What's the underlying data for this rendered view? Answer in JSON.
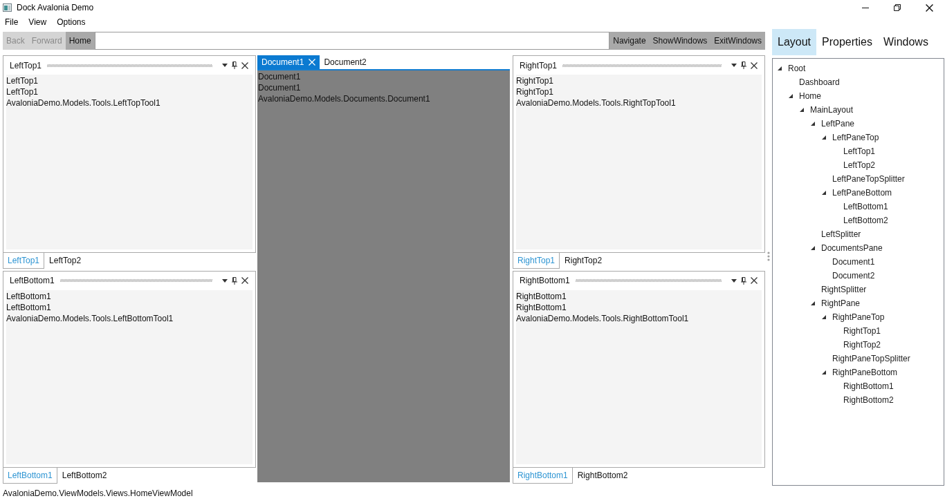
{
  "window": {
    "title": "Dock Avalonia Demo"
  },
  "menu": [
    "File",
    "View",
    "Options"
  ],
  "toolbar": {
    "nav_buttons": [
      {
        "label": "Back",
        "disabled": true
      },
      {
        "label": "Forward",
        "disabled": true
      },
      {
        "label": "Home",
        "disabled": false
      }
    ],
    "action_buttons": [
      {
        "label": "Navigate",
        "disabled": false
      },
      {
        "label": "ShowWindows",
        "disabled": false
      },
      {
        "label": "ExitWindows",
        "disabled": false
      }
    ]
  },
  "dock": {
    "left_panes": [
      {
        "title": "LeftTop1",
        "lines": [
          "LeftTop1",
          "LeftTop1",
          "AvaloniaDemo.Models.Tools.LeftTopTool1"
        ],
        "tabs": [
          {
            "label": "LeftTop1",
            "selected": true
          },
          {
            "label": "LeftTop2",
            "selected": false
          }
        ]
      },
      {
        "title": "LeftBottom1",
        "lines": [
          "LeftBottom1",
          "LeftBottom1",
          "AvaloniaDemo.Models.Tools.LeftBottomTool1"
        ],
        "tabs": [
          {
            "label": "LeftBottom1",
            "selected": true
          },
          {
            "label": "LeftBottom2",
            "selected": false
          }
        ]
      }
    ],
    "documents": {
      "tabs": [
        {
          "label": "Document1",
          "selected": true
        },
        {
          "label": "Document2",
          "selected": false
        }
      ],
      "lines": [
        "Document1",
        "Document1",
        "AvaloniaDemo.Models.Documents.Document1"
      ]
    },
    "right_panes": [
      {
        "title": "RightTop1",
        "lines": [
          "RightTop1",
          "RightTop1",
          "AvaloniaDemo.Models.Tools.RightTopTool1"
        ],
        "tabs": [
          {
            "label": "RightTop1",
            "selected": true
          },
          {
            "label": "RightTop2",
            "selected": false
          }
        ]
      },
      {
        "title": "RightBottom1",
        "lines": [
          "RightBottom1",
          "RightBottom1",
          "AvaloniaDemo.Models.Tools.RightBottomTool1"
        ],
        "tabs": [
          {
            "label": "RightBottom1",
            "selected": true
          },
          {
            "label": "RightBottom2",
            "selected": false
          }
        ]
      }
    ]
  },
  "side_panel": {
    "tabs": [
      {
        "label": "Layout",
        "selected": true
      },
      {
        "label": "Properties",
        "selected": false
      },
      {
        "label": "Windows",
        "selected": false
      }
    ],
    "tree": [
      {
        "label": "Root",
        "expanded": true,
        "children": [
          {
            "label": "Dashboard"
          },
          {
            "label": "Home",
            "expanded": true,
            "children": [
              {
                "label": "MainLayout",
                "expanded": true,
                "children": [
                  {
                    "label": "LeftPane",
                    "expanded": true,
                    "children": [
                      {
                        "label": "LeftPaneTop",
                        "expanded": true,
                        "children": [
                          {
                            "label": "LeftTop1"
                          },
                          {
                            "label": "LeftTop2"
                          }
                        ]
                      },
                      {
                        "label": "LeftPaneTopSplitter"
                      },
                      {
                        "label": "LeftPaneBottom",
                        "expanded": true,
                        "children": [
                          {
                            "label": "LeftBottom1"
                          },
                          {
                            "label": "LeftBottom2"
                          }
                        ]
                      }
                    ]
                  },
                  {
                    "label": "LeftSplitter"
                  },
                  {
                    "label": "DocumentsPane",
                    "expanded": true,
                    "children": [
                      {
                        "label": "Document1"
                      },
                      {
                        "label": "Document2"
                      }
                    ]
                  },
                  {
                    "label": "RightSplitter"
                  },
                  {
                    "label": "RightPane",
                    "expanded": true,
                    "children": [
                      {
                        "label": "RightPaneTop",
                        "expanded": true,
                        "children": [
                          {
                            "label": "RightTop1"
                          },
                          {
                            "label": "RightTop2"
                          }
                        ]
                      },
                      {
                        "label": "RightPaneTopSplitter"
                      },
                      {
                        "label": "RightPaneBottom",
                        "expanded": true,
                        "children": [
                          {
                            "label": "RightBottom1"
                          },
                          {
                            "label": "RightBottom2"
                          }
                        ]
                      }
                    ]
                  }
                ]
              }
            ]
          }
        ]
      }
    ]
  },
  "status_bar": {
    "text": "AvaloniaDemo.ViewModels.Views.HomeViewModel"
  }
}
